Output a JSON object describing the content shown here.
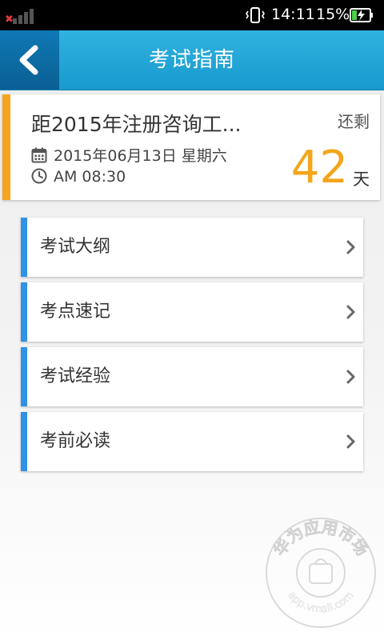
{
  "status_bar": {
    "time": "14:11",
    "battery_percent": "15%",
    "signal_icon": "signal-no-service-icon",
    "vibrate_icon": "vibrate-icon",
    "battery_icon": "battery-charging-icon"
  },
  "header": {
    "title": "考试指南",
    "back_icon": "chevron-left-icon",
    "color": "#1fa3d6"
  },
  "countdown": {
    "exam_title": "距2015年注册咨询工...",
    "date": "2015年06月13日 星期六",
    "time": "AM 08:30",
    "remaining_label": "还剩",
    "days": "42",
    "days_unit": "天",
    "accent_color": "#f5a51c",
    "calendar_icon": "calendar-icon",
    "clock_icon": "clock-icon"
  },
  "menu": {
    "items": [
      {
        "label": "考试大纲"
      },
      {
        "label": "考点速记"
      },
      {
        "label": "考试经验"
      },
      {
        "label": "考前必读"
      }
    ],
    "accent_color": "#2e93e6",
    "chevron_icon": "chevron-right-icon"
  },
  "watermark": {
    "text": "华为应用市场",
    "sub": "app.vmall.com"
  }
}
